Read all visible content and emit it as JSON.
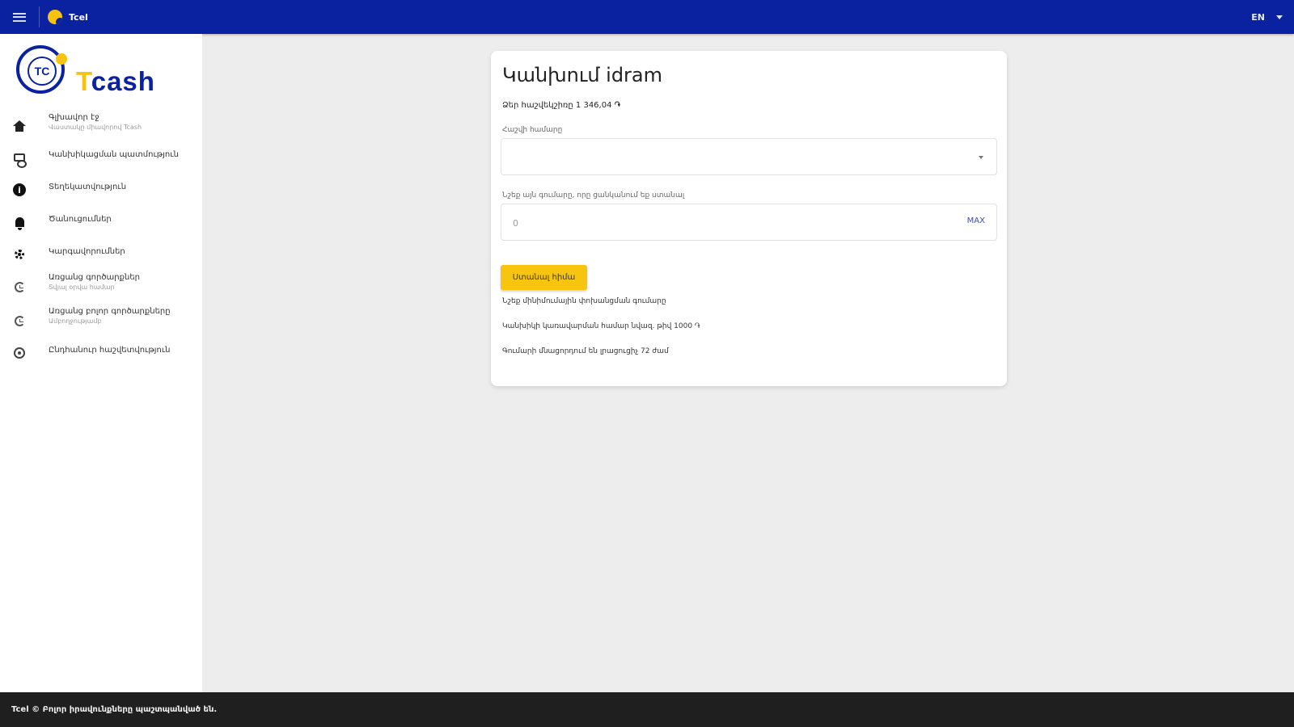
{
  "topbar": {
    "app_name": "Tcel",
    "language": "EN"
  },
  "brand": {
    "logo_letters": "TC",
    "logo_t": "T",
    "logo_rest": "cash"
  },
  "sidebar": {
    "items": [
      {
        "label": "Գլխավոր էջ",
        "sub": "Վաստակը միավորով Tcash",
        "icon": "home-icon"
      },
      {
        "label": "Կանխիկացման պատմություն",
        "sub": "",
        "icon": "money-icon"
      },
      {
        "label": "Տեղեկատվություն",
        "sub": "",
        "icon": "info-icon"
      },
      {
        "label": "Ծանուցումներ",
        "sub": "",
        "icon": "bell-icon"
      },
      {
        "label": "Կարգավորումներ",
        "sub": "",
        "icon": "gear-icon"
      },
      {
        "label": "Առցանց գործարքներ",
        "sub": "Տվյալ օրվա համար",
        "icon": "history-icon"
      },
      {
        "label": "Առցանց բոլոր գործարքները",
        "sub": "Ամբողջությամբ",
        "icon": "history-icon"
      },
      {
        "label": "Ընդհանուր հաշվետվություն",
        "sub": "",
        "icon": "target-icon"
      }
    ]
  },
  "card": {
    "title": "Կանխում idram",
    "balance": "Ձեր հաշվեկշիռը 1 346,04 ֏",
    "account_label": "Հաշվի համարը",
    "account_value": "",
    "amount_label": "Նշեք այն գումարը, որը ցանկանում եք ստանալ",
    "amount_placeholder": "0",
    "max_label": "MAX",
    "submit_label": "Ստանալ հիմա",
    "notes": [
      "Նշեք մինիմումային փոխանցման գումարը",
      "Կանխիկի կառավարման համար նվազ. թիվ 1000 ֏",
      "Գումարի մնացորդում են լրացուցիչ 72 ժամ"
    ]
  },
  "footer": {
    "text": "Tcel © Բոլոր իրավունքները պաշտպանված են."
  },
  "colors": {
    "topbar": "#0a21a0",
    "accent": "#f7c40f",
    "footer": "#1f1f1f",
    "background": "#ededed"
  }
}
